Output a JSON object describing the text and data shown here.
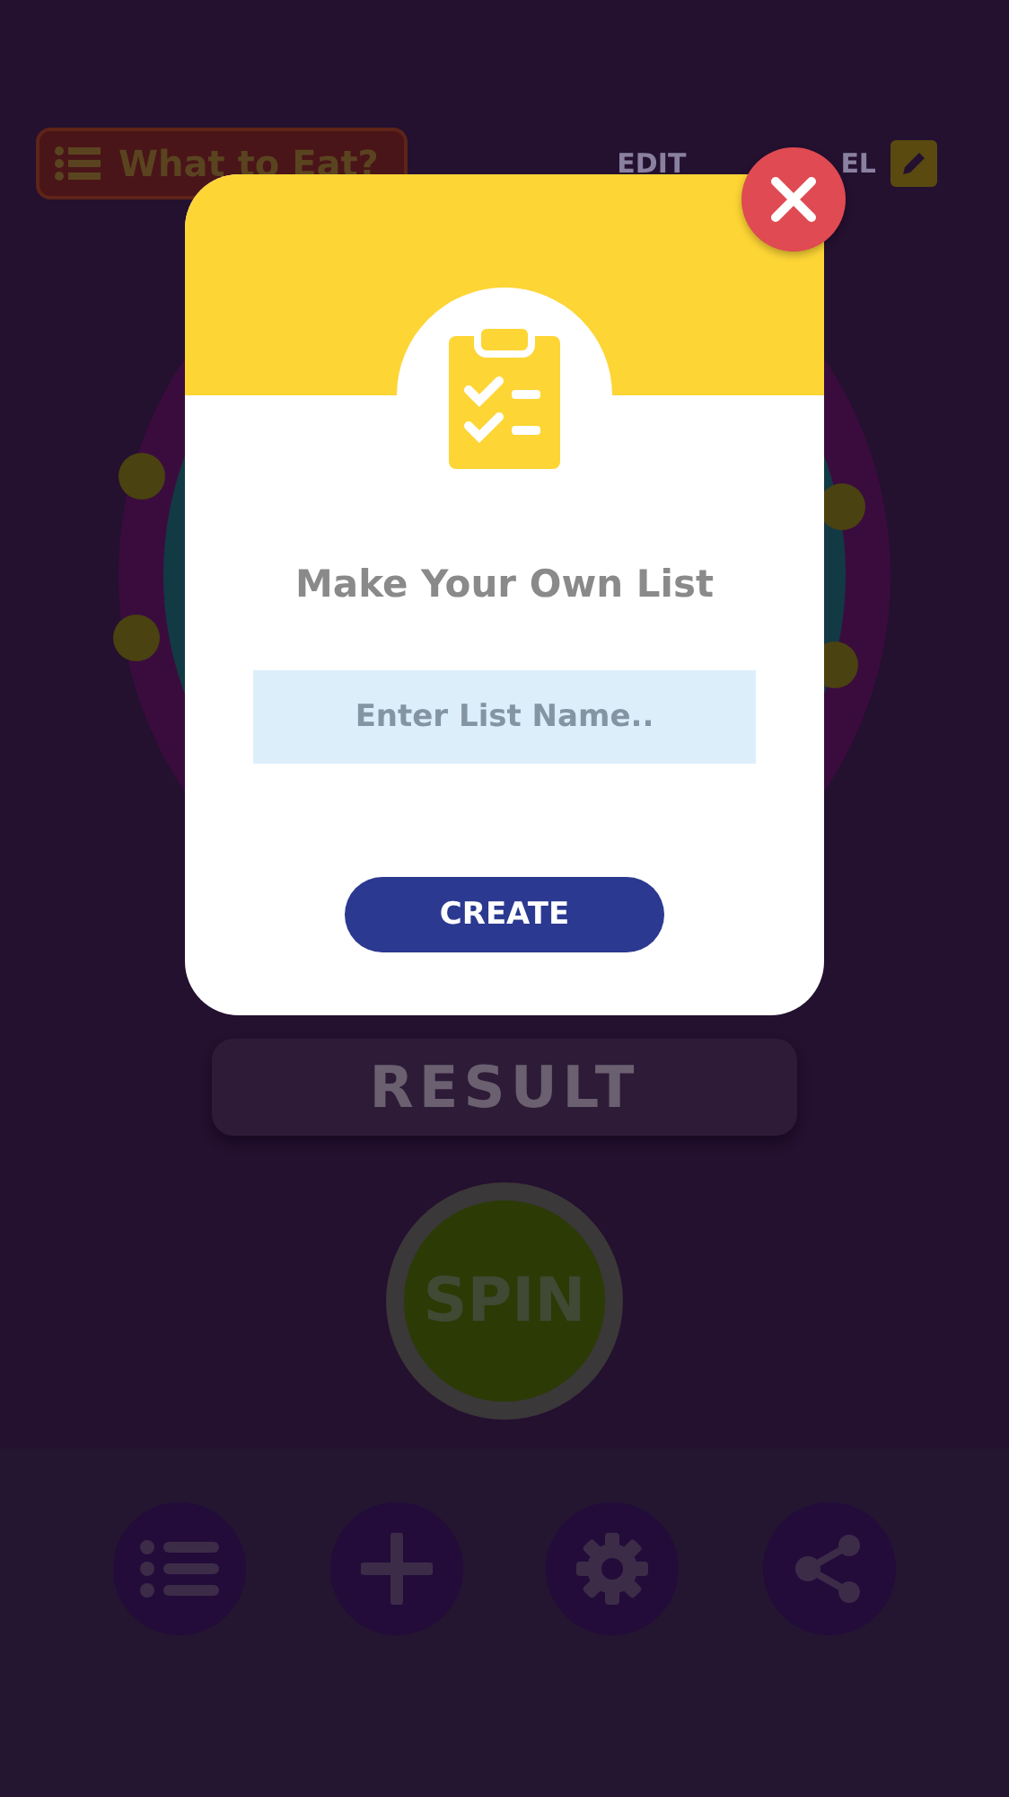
{
  "header": {
    "title": "What to Eat?",
    "edit_label_parts": [
      "EDIT",
      "EL"
    ]
  },
  "result": {
    "label": "RESULT"
  },
  "spin": {
    "label": "SPIN"
  },
  "bottom_nav": [
    {
      "kind": "list"
    },
    {
      "kind": "plus"
    },
    {
      "kind": "gear"
    },
    {
      "kind": "share"
    }
  ],
  "dialog": {
    "title": "Make Your Own List",
    "input": {
      "placeholder": "Enter List Name.."
    },
    "button": "CREATE"
  }
}
